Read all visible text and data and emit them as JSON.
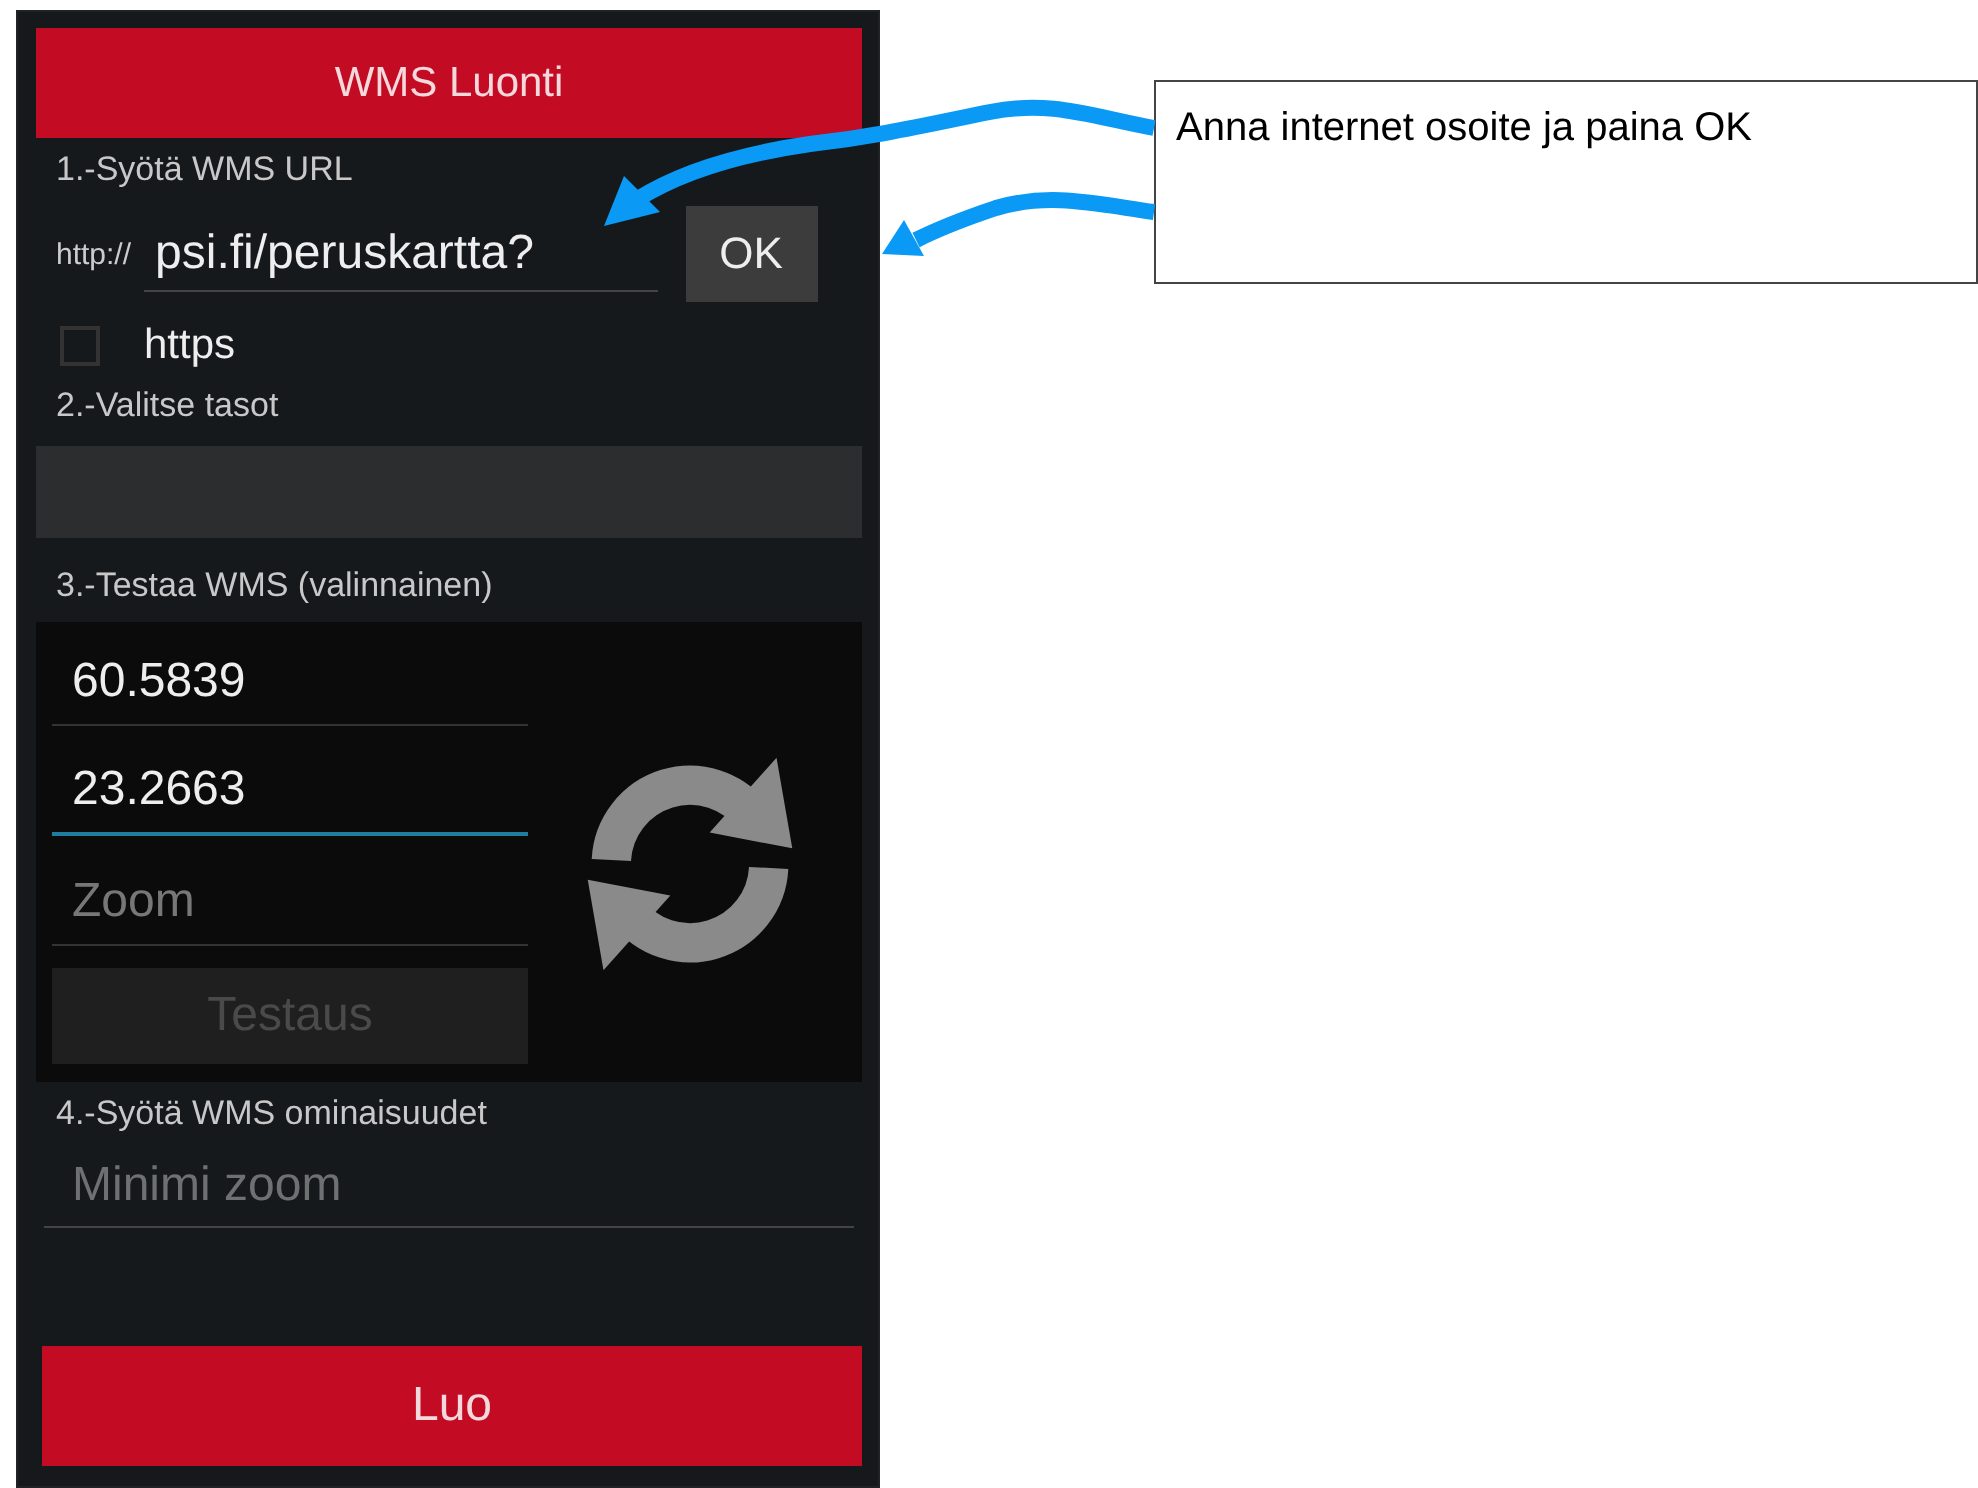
{
  "title": "WMS Luonti",
  "step1": {
    "label": "1.-Syötä WMS URL",
    "prefix": "http://",
    "url": "psi.fi/peruskartta?",
    "ok_button": "OK",
    "https": {
      "label": "https",
      "checked": false
    }
  },
  "step2": {
    "label": "2.-Valitse tasot"
  },
  "step3": {
    "label": "3.-Testaa WMS (valinnainen)",
    "fields": [
      {
        "value": "60.5839",
        "focused": false
      },
      {
        "value": "23.2663",
        "focused": true
      },
      {
        "placeholder": "Zoom",
        "focused": false
      }
    ],
    "test_button": {
      "label": "Testaus",
      "disabled": true
    }
  },
  "step4": {
    "label": "4.-Syötä WMS ominaisuudet",
    "fields": [
      {
        "placeholder": "Minimi zoom"
      }
    ]
  },
  "create_button": "Luo",
  "callout": {
    "text": "Anna internet osoite ja paina OK"
  }
}
